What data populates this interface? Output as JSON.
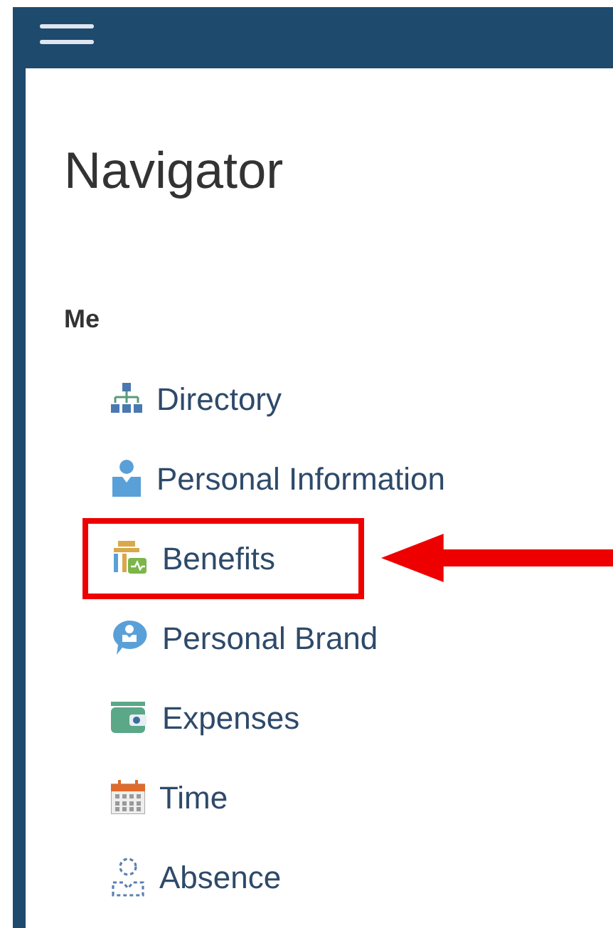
{
  "header": {
    "menu": true
  },
  "title": "Navigator",
  "group": {
    "label": "Me",
    "items": [
      {
        "label": "Directory",
        "highlighted": false
      },
      {
        "label": "Personal Information",
        "highlighted": false
      },
      {
        "label": "Benefits",
        "highlighted": true
      },
      {
        "label": "Personal Brand",
        "highlighted": false
      },
      {
        "label": "Expenses",
        "highlighted": false
      },
      {
        "label": "Time",
        "highlighted": false
      },
      {
        "label": "Absence",
        "highlighted": false
      }
    ]
  }
}
